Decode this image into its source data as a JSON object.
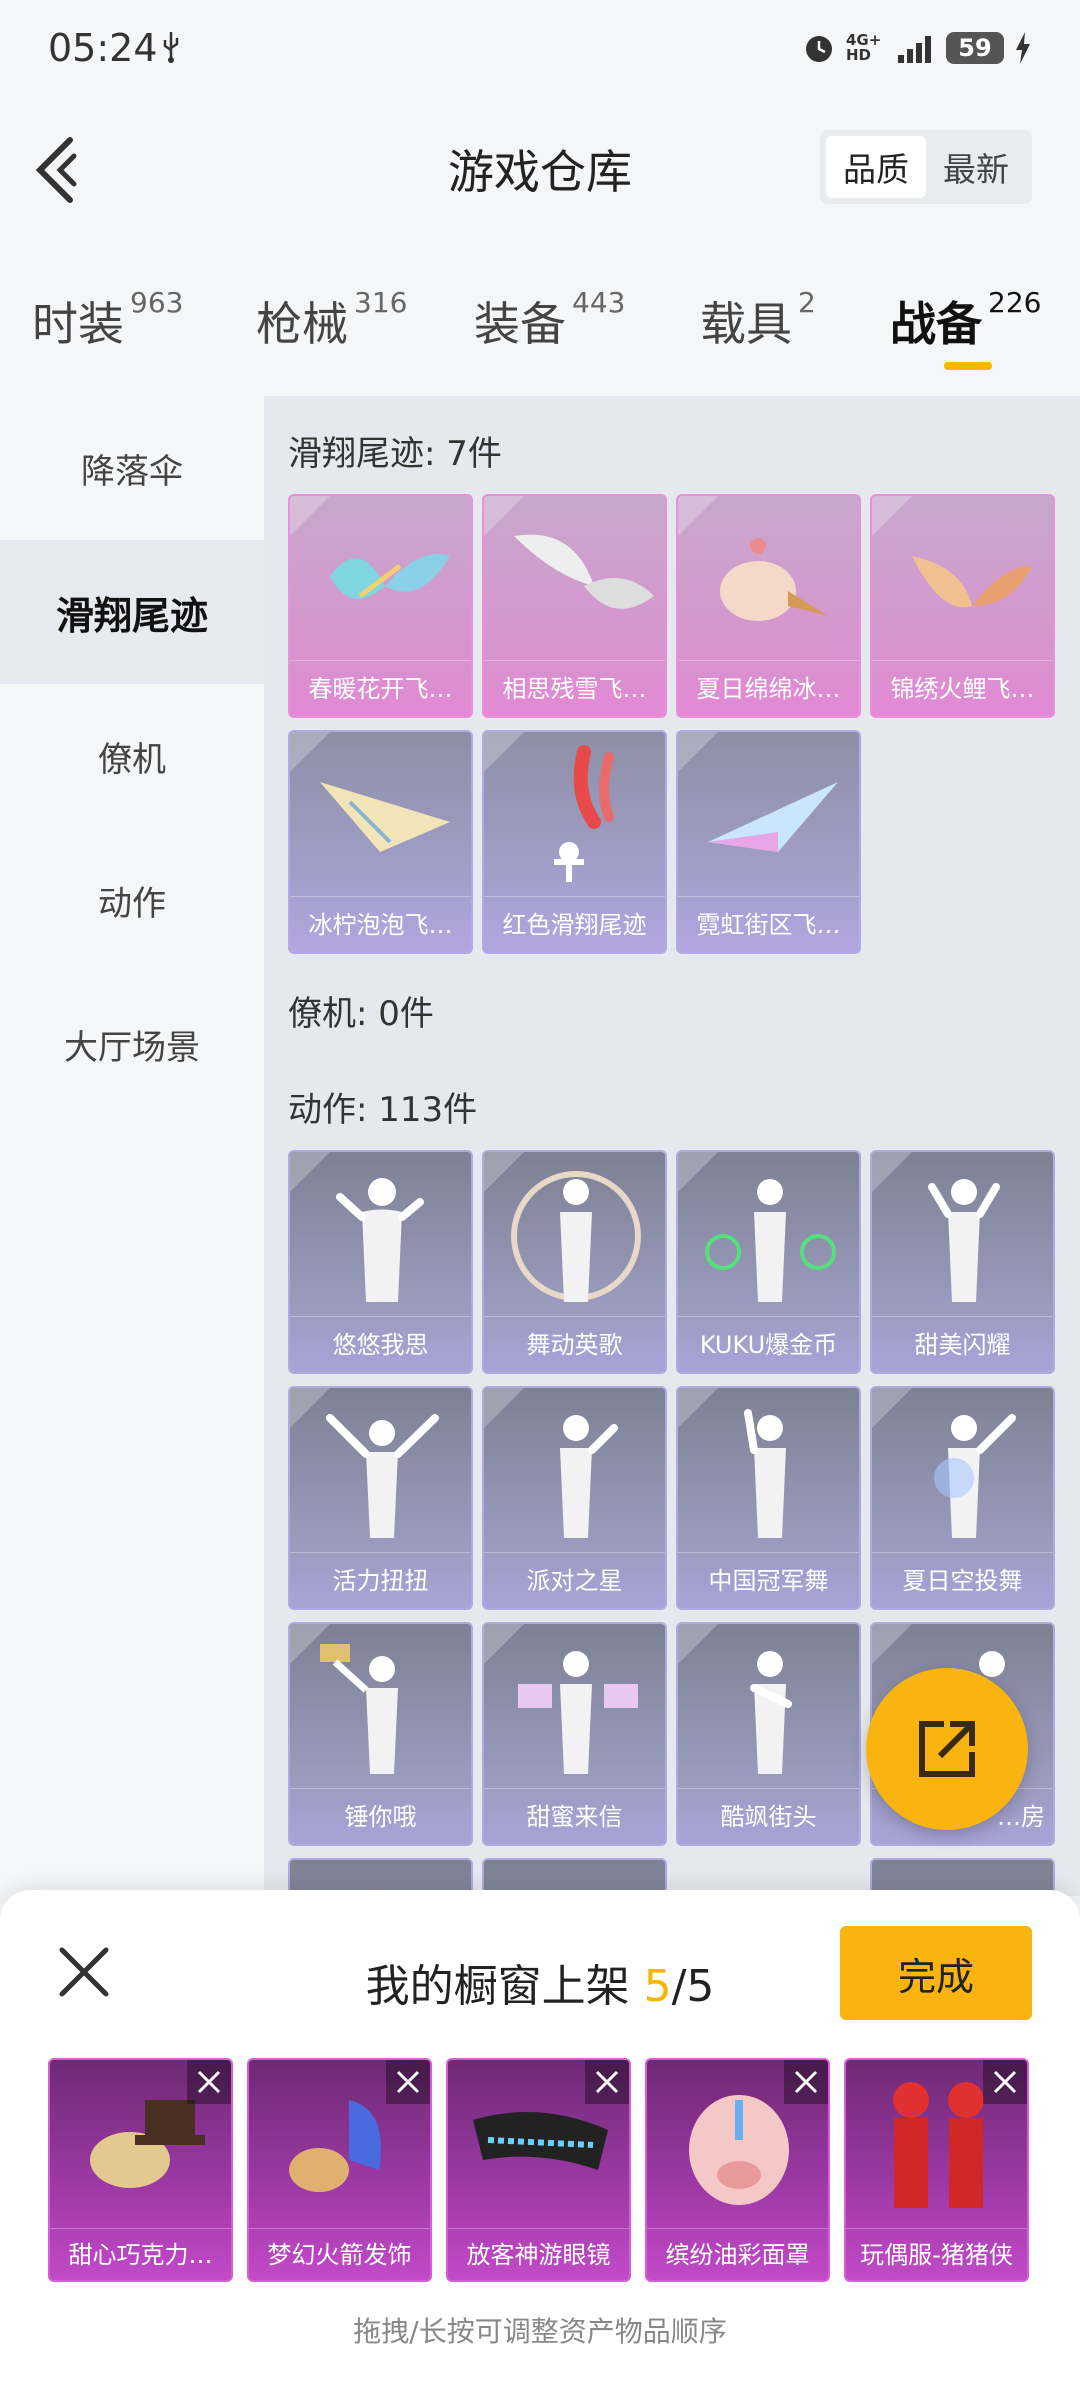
{
  "status_bar": {
    "time": "05:24",
    "network": "4G+ HD",
    "battery": "59"
  },
  "header": {
    "title": "游戏仓库",
    "sort_options": [
      "品质",
      "最新"
    ]
  },
  "tabs": [
    {
      "label": "时装",
      "count": "963"
    },
    {
      "label": "枪械",
      "count": "316"
    },
    {
      "label": "装备",
      "count": "443"
    },
    {
      "label": "载具",
      "count": "2"
    },
    {
      "label": "战备",
      "count": "226"
    }
  ],
  "sidebar": {
    "items": [
      {
        "label": "降落伞"
      },
      {
        "label": "滑翔尾迹"
      },
      {
        "label": "僚机"
      },
      {
        "label": "动作"
      },
      {
        "label": "大厅场景"
      }
    ]
  },
  "sections": {
    "glide": {
      "title": "滑翔尾迹: 7件",
      "items": [
        "春暖花开飞…",
        "相思残雪飞…",
        "夏日绵绵冰…",
        "锦绣火鲤飞…",
        "冰柠泡泡飞…",
        "红色滑翔尾迹",
        "霓虹街区飞…"
      ]
    },
    "wingman": {
      "title": "僚机: 0件"
    },
    "emote": {
      "title": "动作: 113件",
      "items": [
        "悠悠我思",
        "舞动英歌",
        "KUKU爆金币",
        "甜美闪耀",
        "活力扭扭",
        "派对之星",
        "中国冠军舞",
        "夏日空投舞",
        "锤你哦",
        "甜蜜来信",
        "酷飒街头",
        "…房"
      ]
    }
  },
  "sheet": {
    "title_prefix": "我的橱窗上架 ",
    "count_current": "5",
    "count_total": "/5",
    "done_label": "完成",
    "items": [
      "甜心巧克力…",
      "梦幻火箭发饰",
      "放客神游眼镜",
      "缤纷油彩面罩",
      "玩偶服-猪猪侠"
    ],
    "hint": "拖拽/长按可调整资产物品顺序"
  },
  "colors": {
    "accent": "#f9b410",
    "highlight": "#f7b500"
  }
}
